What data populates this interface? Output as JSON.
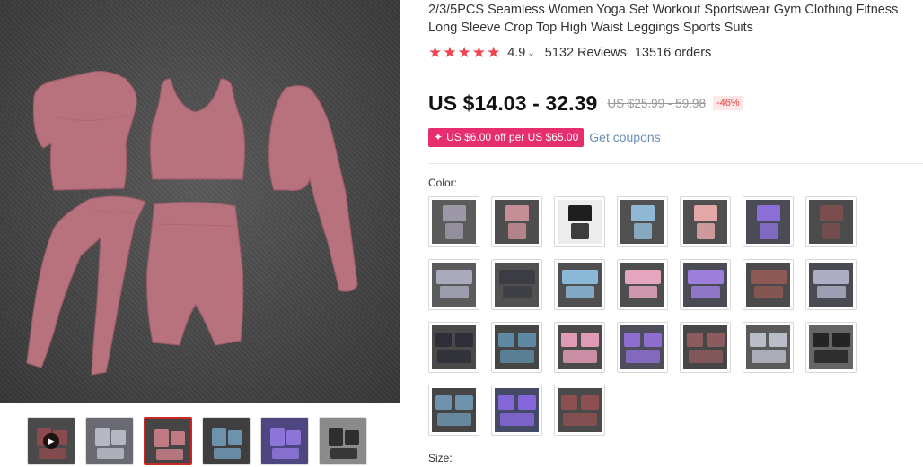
{
  "product": {
    "title": "2/3/5PCS Seamless Women Yoga Set Workout Sportswear Gym Clothing Fitness Long Sleeve Crop Top High Waist Leggings Sports Suits",
    "rating_stars": "★★★★★",
    "rating_value": "4.9",
    "reviews": "5132 Reviews",
    "orders": "13516 orders",
    "price": "US $14.03 - 32.39",
    "original_price": "US $25.99 - 59.98",
    "discount": "-46%",
    "coupon_text": "US $6.00 off per US $65.00",
    "get_coupons": "Get coupons",
    "color_label": "Color:",
    "size_label": "Size:"
  },
  "colors": {
    "accent_red": "#f0454f",
    "coupon_pink": "#e62e6e",
    "link_blue": "#6b8fb4",
    "main_garment": "#b8727e"
  },
  "gallery": {
    "thumbnails": [
      {
        "name": "thumb-video",
        "bg": "#4a4a4a",
        "garment": "#8a4a4e",
        "has_video": true
      },
      {
        "name": "thumb-grey-set",
        "bg": "#6a6a72",
        "garment": "#b7b7c4",
        "has_video": false
      },
      {
        "name": "thumb-pink-set",
        "bg": "#454545",
        "garment": "#c07a82",
        "has_video": false
      },
      {
        "name": "thumb-blue-set",
        "bg": "#3f3f3f",
        "garment": "#6d92ad",
        "has_video": false
      },
      {
        "name": "thumb-purple-set",
        "bg": "#4d4680",
        "garment": "#8c74d8",
        "has_video": false
      },
      {
        "name": "thumb-black-set",
        "bg": "#8a8a8a",
        "garment": "#2e2e2e",
        "has_video": false
      }
    ]
  },
  "color_options": [
    {
      "bg": "#5b5b5b",
      "garment": "#9c98a8"
    },
    {
      "bg": "#4e4e4e",
      "garment": "#c58d96"
    },
    {
      "bg": "#ececec",
      "garment": "#1e1e1e"
    },
    {
      "bg": "#505050",
      "garment": "#8fb8d4"
    },
    {
      "bg": "#4f4f4f",
      "garment": "#e3a7a8"
    },
    {
      "bg": "#4b4b55",
      "garment": "#8b6ed6"
    },
    {
      "bg": "#4b4b4b",
      "garment": "#7a4e4d"
    },
    {
      "bg": "#5b5b5b",
      "garment": "#a8a9bb"
    },
    {
      "bg": "#515151",
      "garment": "#3c3c44"
    },
    {
      "bg": "#4f4f4f",
      "garment": "#89b9d7"
    },
    {
      "bg": "#4e4e4e",
      "garment": "#e5a5bf"
    },
    {
      "bg": "#4b4b55",
      "garment": "#9b7fda"
    },
    {
      "bg": "#4b4b4b",
      "garment": "#8e5854"
    },
    {
      "bg": "#4a4a52",
      "garment": "#adadc4"
    },
    {
      "bg": "#4a4a4a",
      "garment": "#2e2e38"
    },
    {
      "bg": "#454545",
      "garment": "#5d8aa2"
    },
    {
      "bg": "#4a4a4a",
      "garment": "#e09ab5"
    },
    {
      "bg": "#4d4d5c",
      "garment": "#8d6ecf"
    },
    {
      "bg": "#464646",
      "garment": "#8c5b5e"
    },
    {
      "bg": "#5a5a5a",
      "garment": "#b9bcc9"
    },
    {
      "bg": "#656565",
      "garment": "#242424"
    },
    {
      "bg": "#454545",
      "garment": "#6d93ac"
    },
    {
      "bg": "#444a66",
      "garment": "#8566d8"
    },
    {
      "bg": "#4a4a4a",
      "garment": "#8d4f50"
    }
  ]
}
